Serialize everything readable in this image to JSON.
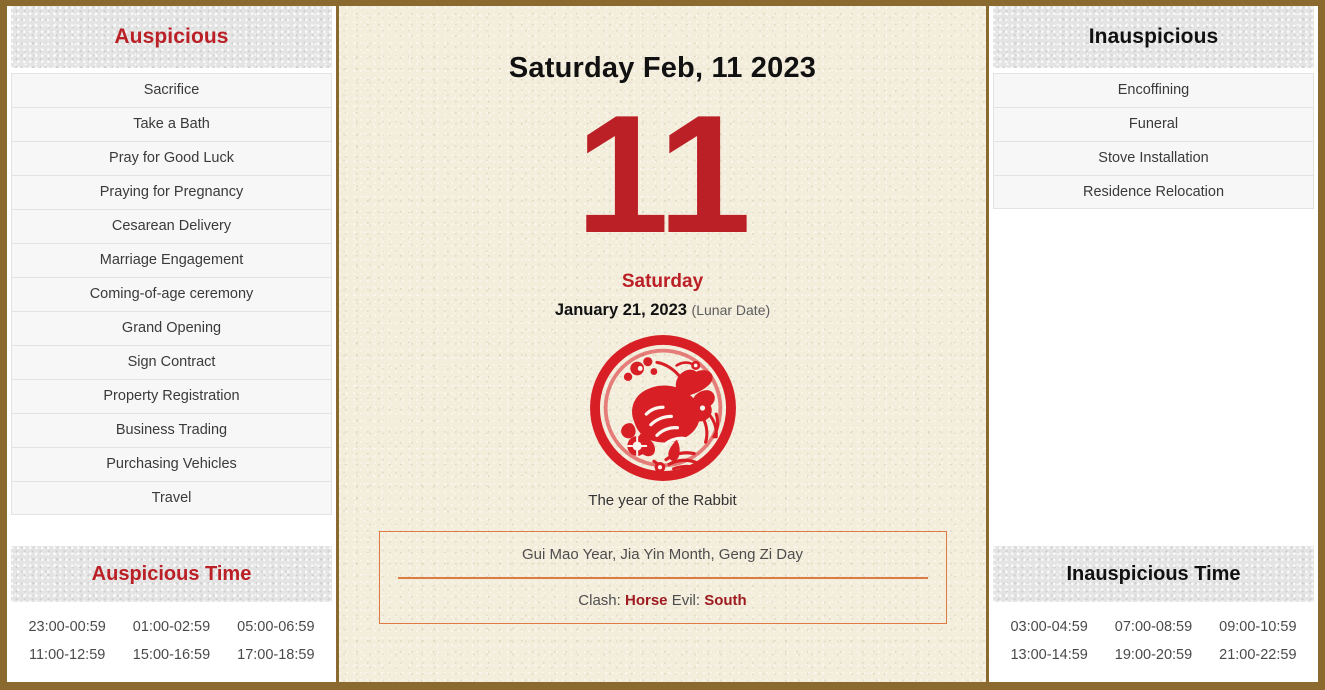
{
  "theme": {
    "frame_color": "#8a6a2f",
    "accent_red": "#bb2026",
    "info_border": "#dd7b45",
    "paper_cream": "#f3eddc",
    "header_gray": "#e4e4e4"
  },
  "left_panel": {
    "header": "Auspicious",
    "items": [
      "Sacrifice",
      "Take a Bath",
      "Pray for Good Luck",
      "Praying for Pregnancy",
      "Cesarean Delivery",
      "Marriage Engagement",
      "Coming-of-age ceremony",
      "Grand Opening",
      "Sign Contract",
      "Property Registration",
      "Business Trading",
      "Purchasing Vehicles",
      "Travel"
    ],
    "time_header": "Auspicious Time",
    "times": [
      "23:00-00:59",
      "01:00-02:59",
      "05:00-06:59",
      "11:00-12:59",
      "15:00-16:59",
      "17:00-18:59"
    ]
  },
  "center_panel": {
    "title": "Saturday Feb, 11 2023",
    "day_number": "11",
    "weekday": "Saturday",
    "lunar_date": "January 21, 2023",
    "lunar_suffix": "(Lunar Date)",
    "zodiac_icon": "rabbit-papercut-icon",
    "zodiac_caption": "The year of the Rabbit",
    "info_box": {
      "pillars": "Gui Mao Year, Jia Yin Month, Geng Zi Day",
      "clash_label": "Clash:",
      "clash_value": "Horse",
      "evil_label": "Evil:",
      "evil_value": "South"
    }
  },
  "right_panel": {
    "header": "Inauspicious",
    "items": [
      "Encoffining",
      "Funeral",
      "Stove Installation",
      "Residence Relocation"
    ],
    "time_header": "Inauspicious Time",
    "times": [
      "03:00-04:59",
      "07:00-08:59",
      "09:00-10:59",
      "13:00-14:59",
      "19:00-20:59",
      "21:00-22:59"
    ]
  }
}
